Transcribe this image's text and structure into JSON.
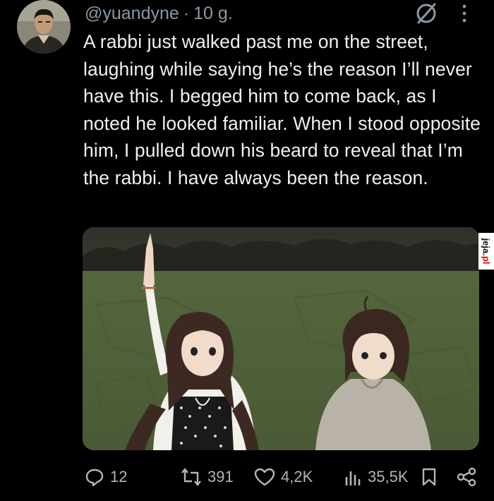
{
  "tweet": {
    "handle": "@yuandyne",
    "separator": "·",
    "time": "10 g.",
    "text": "A rabbi just walked past me on the street, laughing while saying he’s the reason I’ll never have this. I begged him to come back, as I noted he looked familiar. When I stood opposite him, I pulled down his beard to reveal that I’m the rabbi. I have always been the reason."
  },
  "watermark": {
    "brand": "jeja",
    "suffix": ".pl"
  },
  "actions": {
    "replies": "12",
    "reposts": "391",
    "likes": "4,2K",
    "views": "35,5K"
  },
  "icons": [
    "avatar",
    "null-icon",
    "more-icon",
    "reply-icon",
    "repost-icon",
    "like-icon",
    "views-icon",
    "bookmark-icon",
    "share-icon"
  ],
  "colors": {
    "background": "#000000",
    "text": "#e7e9ea",
    "muted": "#8b98a5",
    "watermark_accent": "#e60000"
  }
}
